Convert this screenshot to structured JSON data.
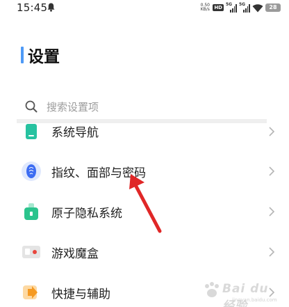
{
  "status_bar": {
    "time": "15:45",
    "net_speed_value": "0.50",
    "net_speed_unit": "KB/s",
    "hd_label": "HD",
    "signal_1_label": "5G",
    "signal_2_label": "5G",
    "battery_level": "28"
  },
  "header": {
    "title": "设置",
    "accent_color": "#4e9af6"
  },
  "search": {
    "placeholder": "搜索设置项"
  },
  "settings_list": [
    {
      "label": "系统导航",
      "icon": "navigation-icon",
      "icon_color": "#27c2a0"
    },
    {
      "label": "指纹、面部与密码",
      "icon": "fingerprint-icon",
      "icon_color": "#3c6cf2"
    },
    {
      "label": "原子隐私系统",
      "icon": "privacy-icon",
      "icon_color": "#2bc48d"
    },
    {
      "label": "游戏魔盒",
      "icon": "game-box-icon",
      "icon_color": "#e8453c"
    },
    {
      "label": "快捷与辅助",
      "icon": "shortcut-icon",
      "icon_color": "#f59a23"
    }
  ],
  "annotation": {
    "arrow_color": "#e02727"
  },
  "watermark": {
    "text": "Bai du 经验",
    "sub": "jingyan.baidu.com"
  }
}
